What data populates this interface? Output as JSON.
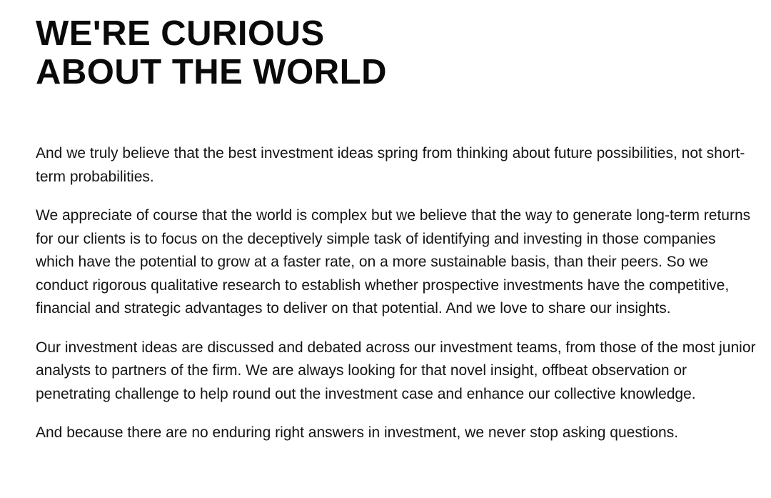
{
  "heading": {
    "line1": "WE'RE CURIOUS",
    "line2": "ABOUT THE WORLD"
  },
  "paragraphs": [
    "And we truly believe that the best investment ideas spring from thinking about future possibilities, not short-term probabilities.",
    "We appreciate of course that the world is complex but we believe that the way to generate long-term returns for our clients is to focus on the deceptively simple task of identifying and investing in those companies which have the potential to grow at a faster rate, on a more sustainable basis, than their peers. So we conduct rigorous qualitative research to establish whether prospective investments have the competitive, financial and strategic advantages to deliver on that potential. And we love to share our insights.",
    "Our investment ideas are discussed and debated across our investment teams, from those of the most junior analysts to partners of the firm. We are always looking for that novel insight, offbeat observation or penetrating challenge to help round out the investment case and enhance our collective knowledge.",
    "And because there are no enduring right answers in investment, we never stop asking questions."
  ]
}
